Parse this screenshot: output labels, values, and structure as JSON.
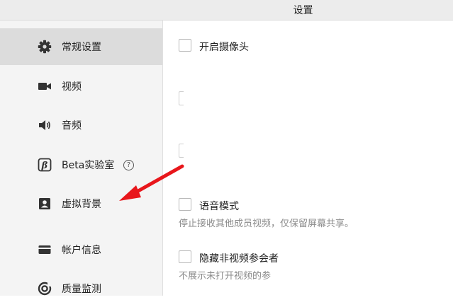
{
  "window": {
    "title": "设置"
  },
  "sidebar": {
    "items": [
      {
        "label": "常规设置",
        "icon": "gear-icon",
        "active": true
      },
      {
        "label": "视频",
        "icon": "video-camera-icon"
      },
      {
        "label": "音频",
        "icon": "speaker-icon"
      },
      {
        "label": "Beta实验室",
        "icon": "beta-icon",
        "help": "?"
      },
      {
        "label": "虚拟背景",
        "icon": "person-portrait-icon"
      },
      {
        "label": "帐户信息",
        "icon": "card-icon"
      },
      {
        "label": "质量监测",
        "icon": "monitor-gauge-icon"
      }
    ]
  },
  "main": {
    "options": [
      {
        "label": "开启摄像头",
        "checked": false
      },
      {
        "label": "语音模式",
        "description": "停止接收其他成员视频，仅保留屏幕共享。",
        "checked": false
      },
      {
        "label": "隐藏非视频参会者",
        "description": "不展示未打开视频的参",
        "checked": false
      }
    ]
  },
  "colors": {
    "annotation_arrow": "#e8161b",
    "active_item_bg": "#dcdcdc"
  }
}
